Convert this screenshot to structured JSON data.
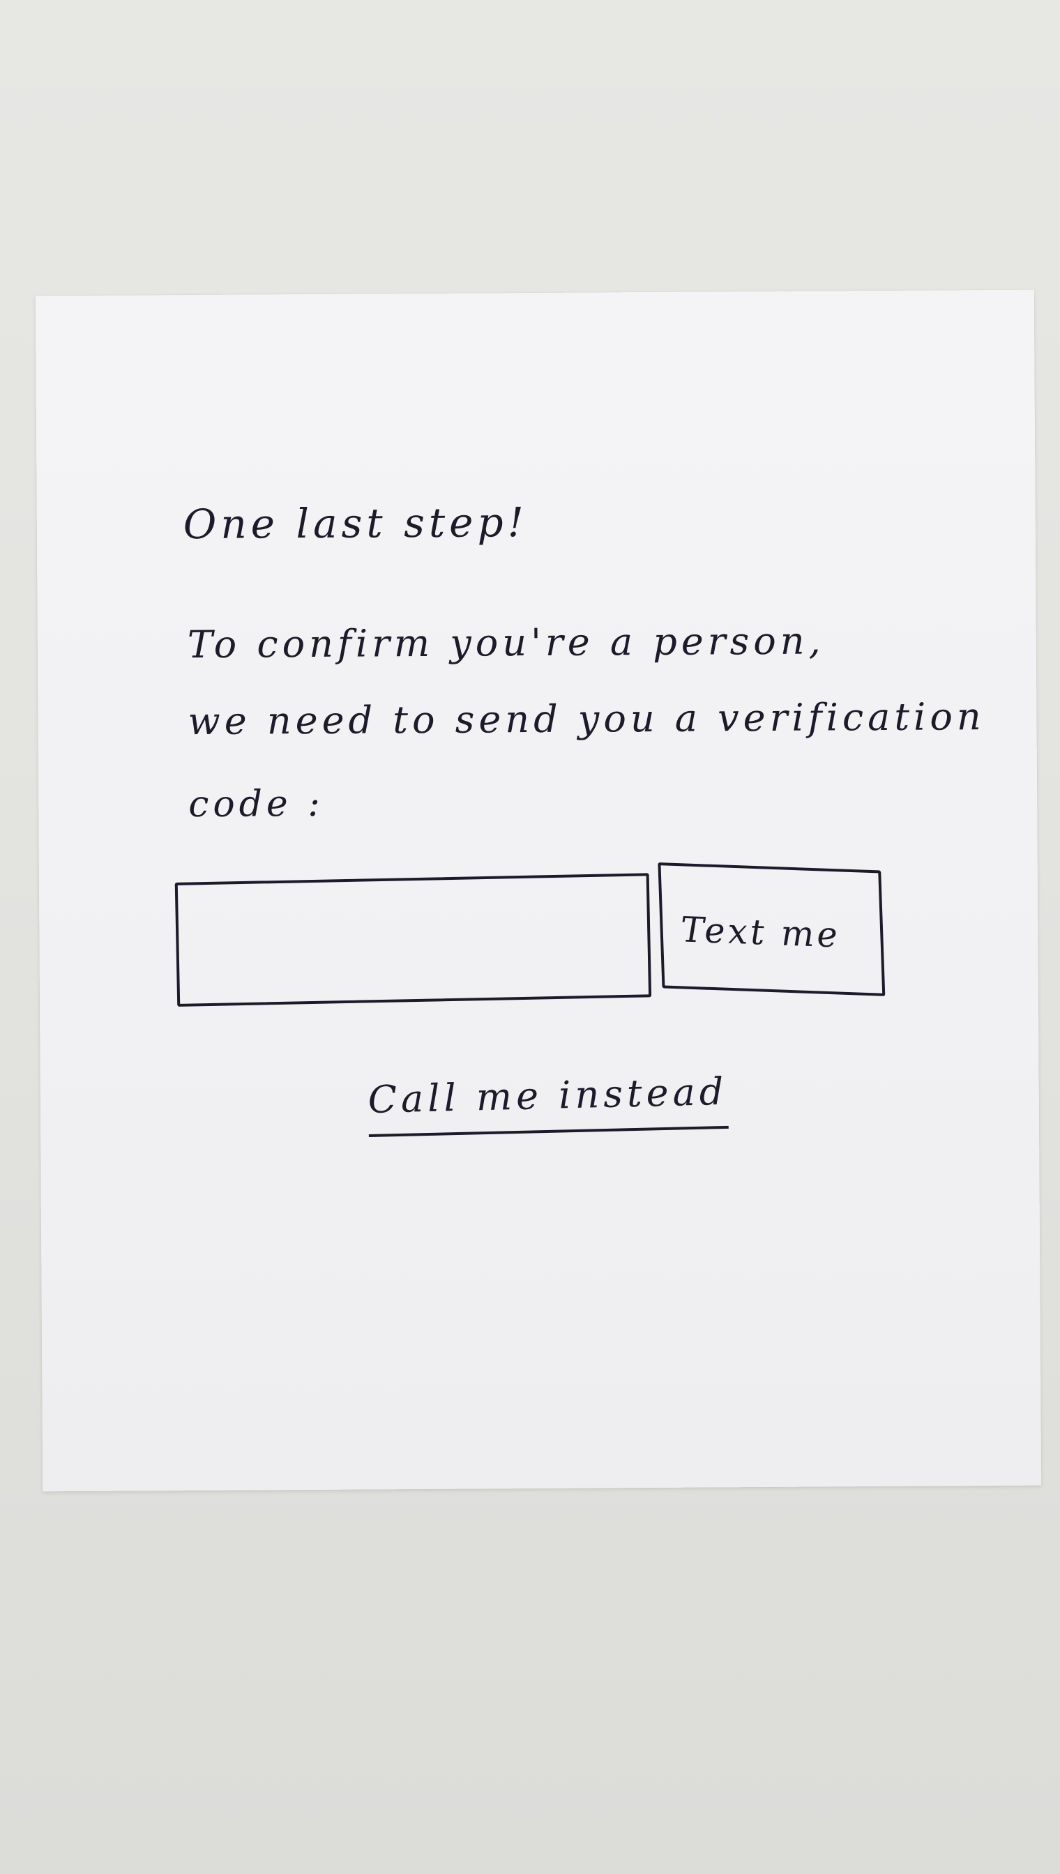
{
  "page": {
    "title": "One last step!",
    "instructions": [
      "To confirm you're a person,",
      "we need to send you a verification",
      "code :"
    ]
  },
  "form": {
    "code_input": {
      "value": "",
      "placeholder": ""
    },
    "text_me_label": "Text me",
    "call_me_label": "Call me instead"
  }
}
